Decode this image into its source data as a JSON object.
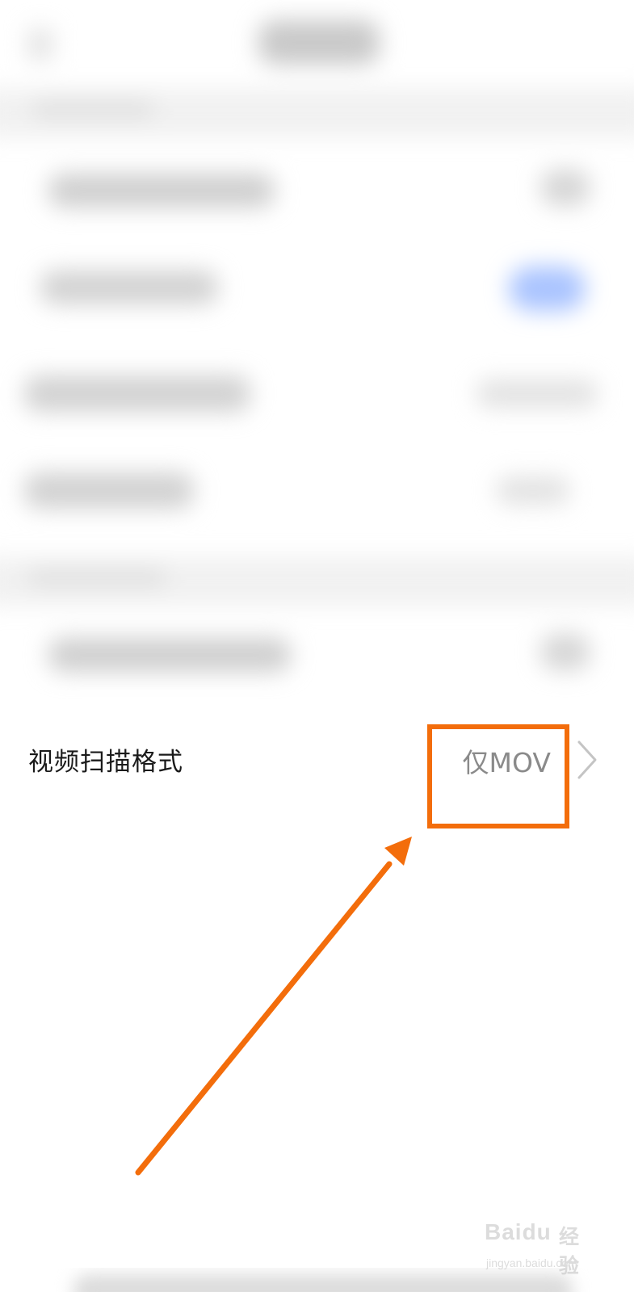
{
  "settings_row": {
    "label": "视频扫描格式",
    "value": "仅MOV"
  },
  "watermark": {
    "brand": "Baidu",
    "suffix": "经验",
    "domain": "jingyan.baidu.com"
  },
  "colors": {
    "annotation": "#f36d0b",
    "value_text": "#8a8a8a",
    "label_text": "#1a1a1a",
    "toggle_accent": "#aac4ff"
  },
  "icons": {
    "chevron": "chevron-right-icon",
    "annotation_arrow": "arrow-icon"
  }
}
